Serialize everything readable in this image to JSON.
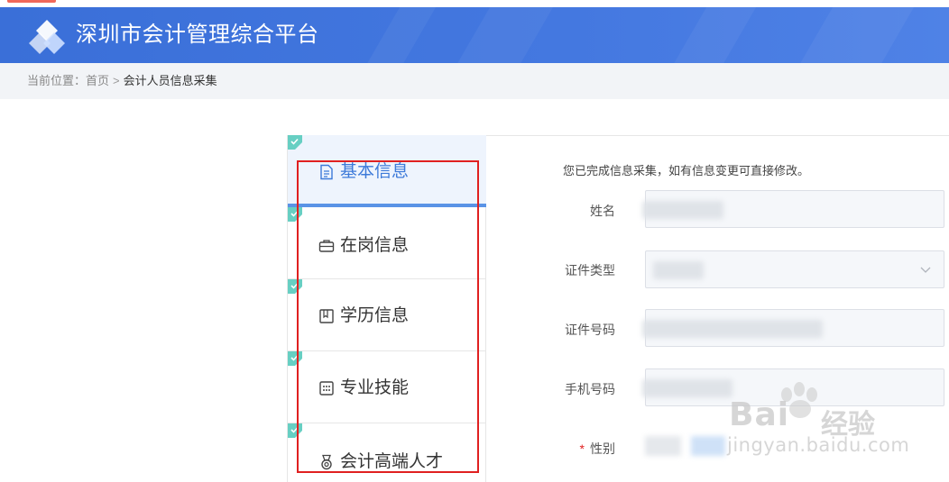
{
  "header": {
    "title": "深圳市会计管理综合平台"
  },
  "breadcrumb": {
    "prefix": "当前位置：",
    "home": "首页",
    "separator": ">",
    "current": "会计人员信息采集"
  },
  "steps": [
    {
      "label": "基本信息",
      "icon": "document-icon",
      "active": true,
      "completed": true
    },
    {
      "label": "在岗信息",
      "icon": "briefcase-icon",
      "active": false,
      "completed": true
    },
    {
      "label": "学历信息",
      "icon": "book-icon",
      "active": false,
      "completed": true
    },
    {
      "label": "专业技能",
      "icon": "calculator-icon",
      "active": false,
      "completed": true
    },
    {
      "label": "会计高端人才",
      "icon": "medal-icon",
      "active": false,
      "completed": true
    }
  ],
  "form": {
    "notice": "您已完成信息采集，如有信息变更可直接修改。",
    "fields": {
      "name_label": "姓名",
      "id_type_label": "证件类型",
      "id_number_label": "证件号码",
      "phone_label": "手机号码",
      "gender_label": "性别",
      "gender_required": "*"
    }
  },
  "watermark": {
    "brand": "Bai",
    "brand2": "经验",
    "url": "jingyan.baidu.com"
  },
  "colors": {
    "header": "#4478e0",
    "active_step": "#3d7ad9",
    "check": "#67cfc3",
    "highlight_box": "#e02020"
  }
}
